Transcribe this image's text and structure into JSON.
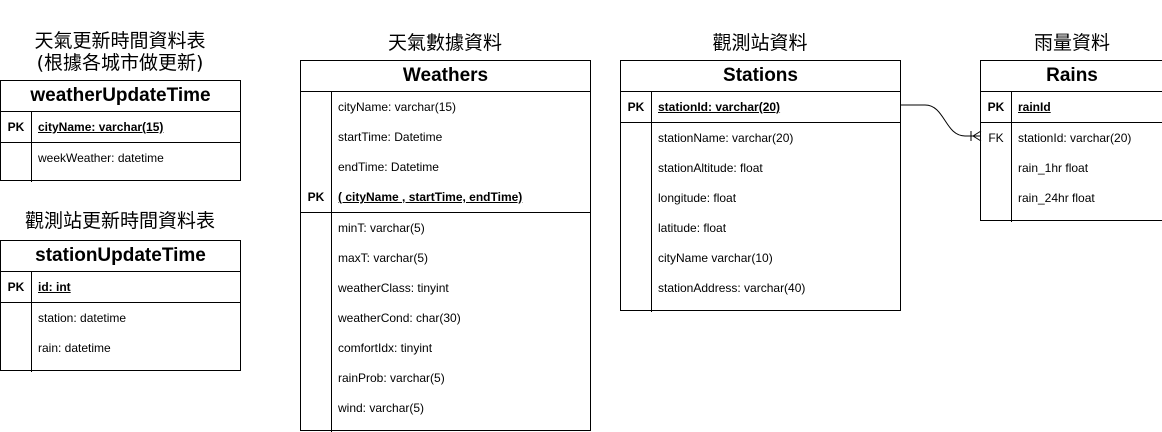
{
  "captions": {
    "weather_update_line1": "天氣更新時間資料表",
    "weather_update_line2": "(根據各城市做更新)",
    "station_update": "觀測站更新時間資料表",
    "weathers": "天氣數據資料",
    "stations": "觀測站資料",
    "rains": "雨量資料"
  },
  "tables": {
    "weatherUpdateTime": {
      "name": "weatherUpdateTime",
      "key_section": [
        {
          "key": "PK",
          "field": "cityName: varchar(15)"
        }
      ],
      "fields": [
        {
          "key": "",
          "field": "weekWeather: datetime"
        }
      ]
    },
    "stationUpdateTime": {
      "name": "stationUpdateTime",
      "key_section": [
        {
          "key": "PK",
          "field": "id: int"
        }
      ],
      "fields": [
        {
          "key": "",
          "field": "station: datetime"
        },
        {
          "key": "",
          "field": "rain: datetime"
        }
      ]
    },
    "Weathers": {
      "name": "Weathers",
      "key_section": [
        {
          "key": "",
          "field": "cityName: varchar(15)"
        },
        {
          "key": "",
          "field": "startTime: Datetime"
        },
        {
          "key": "",
          "field": "endTime: Datetime"
        },
        {
          "key": "PK",
          "field": "( cityName , startTime, endTime)"
        }
      ],
      "fields": [
        {
          "key": "",
          "field": "minT:  varchar(5)"
        },
        {
          "key": "",
          "field": "maxT: varchar(5)"
        },
        {
          "key": "",
          "field": "weatherClass: tinyint"
        },
        {
          "key": "",
          "field": "weatherCond:  char(30)"
        },
        {
          "key": "",
          "field": "comfortIdx: tinyint"
        },
        {
          "key": "",
          "field": "rainProb: varchar(5)"
        },
        {
          "key": "",
          "field": "wind: varchar(5)"
        }
      ]
    },
    "Stations": {
      "name": "Stations",
      "key_section": [
        {
          "key": "PK",
          "field": "stationId: varchar(20)"
        }
      ],
      "fields": [
        {
          "key": "",
          "field": "stationName: varchar(20)"
        },
        {
          "key": "",
          "field": "stationAltitude: float"
        },
        {
          "key": "",
          "field": "longitude: float"
        },
        {
          "key": "",
          "field": "latitude: float"
        },
        {
          "key": "",
          "field": "cityName varchar(10)"
        },
        {
          "key": "",
          "field": "stationAddress: varchar(40)"
        }
      ]
    },
    "Rains": {
      "name": "Rains",
      "key_section": [
        {
          "key": "PK",
          "field": "rainId"
        }
      ],
      "fields": [
        {
          "key": "FK",
          "field": "stationId: varchar(20)"
        },
        {
          "key": "",
          "field": "rain_1hr float"
        },
        {
          "key": "",
          "field": "rain_24hr float"
        }
      ]
    }
  },
  "relationships": [
    {
      "from": "Stations.stationId",
      "to": "Rains.stationId",
      "from_cardinality": "one",
      "to_cardinality": "one-or-many"
    }
  ]
}
